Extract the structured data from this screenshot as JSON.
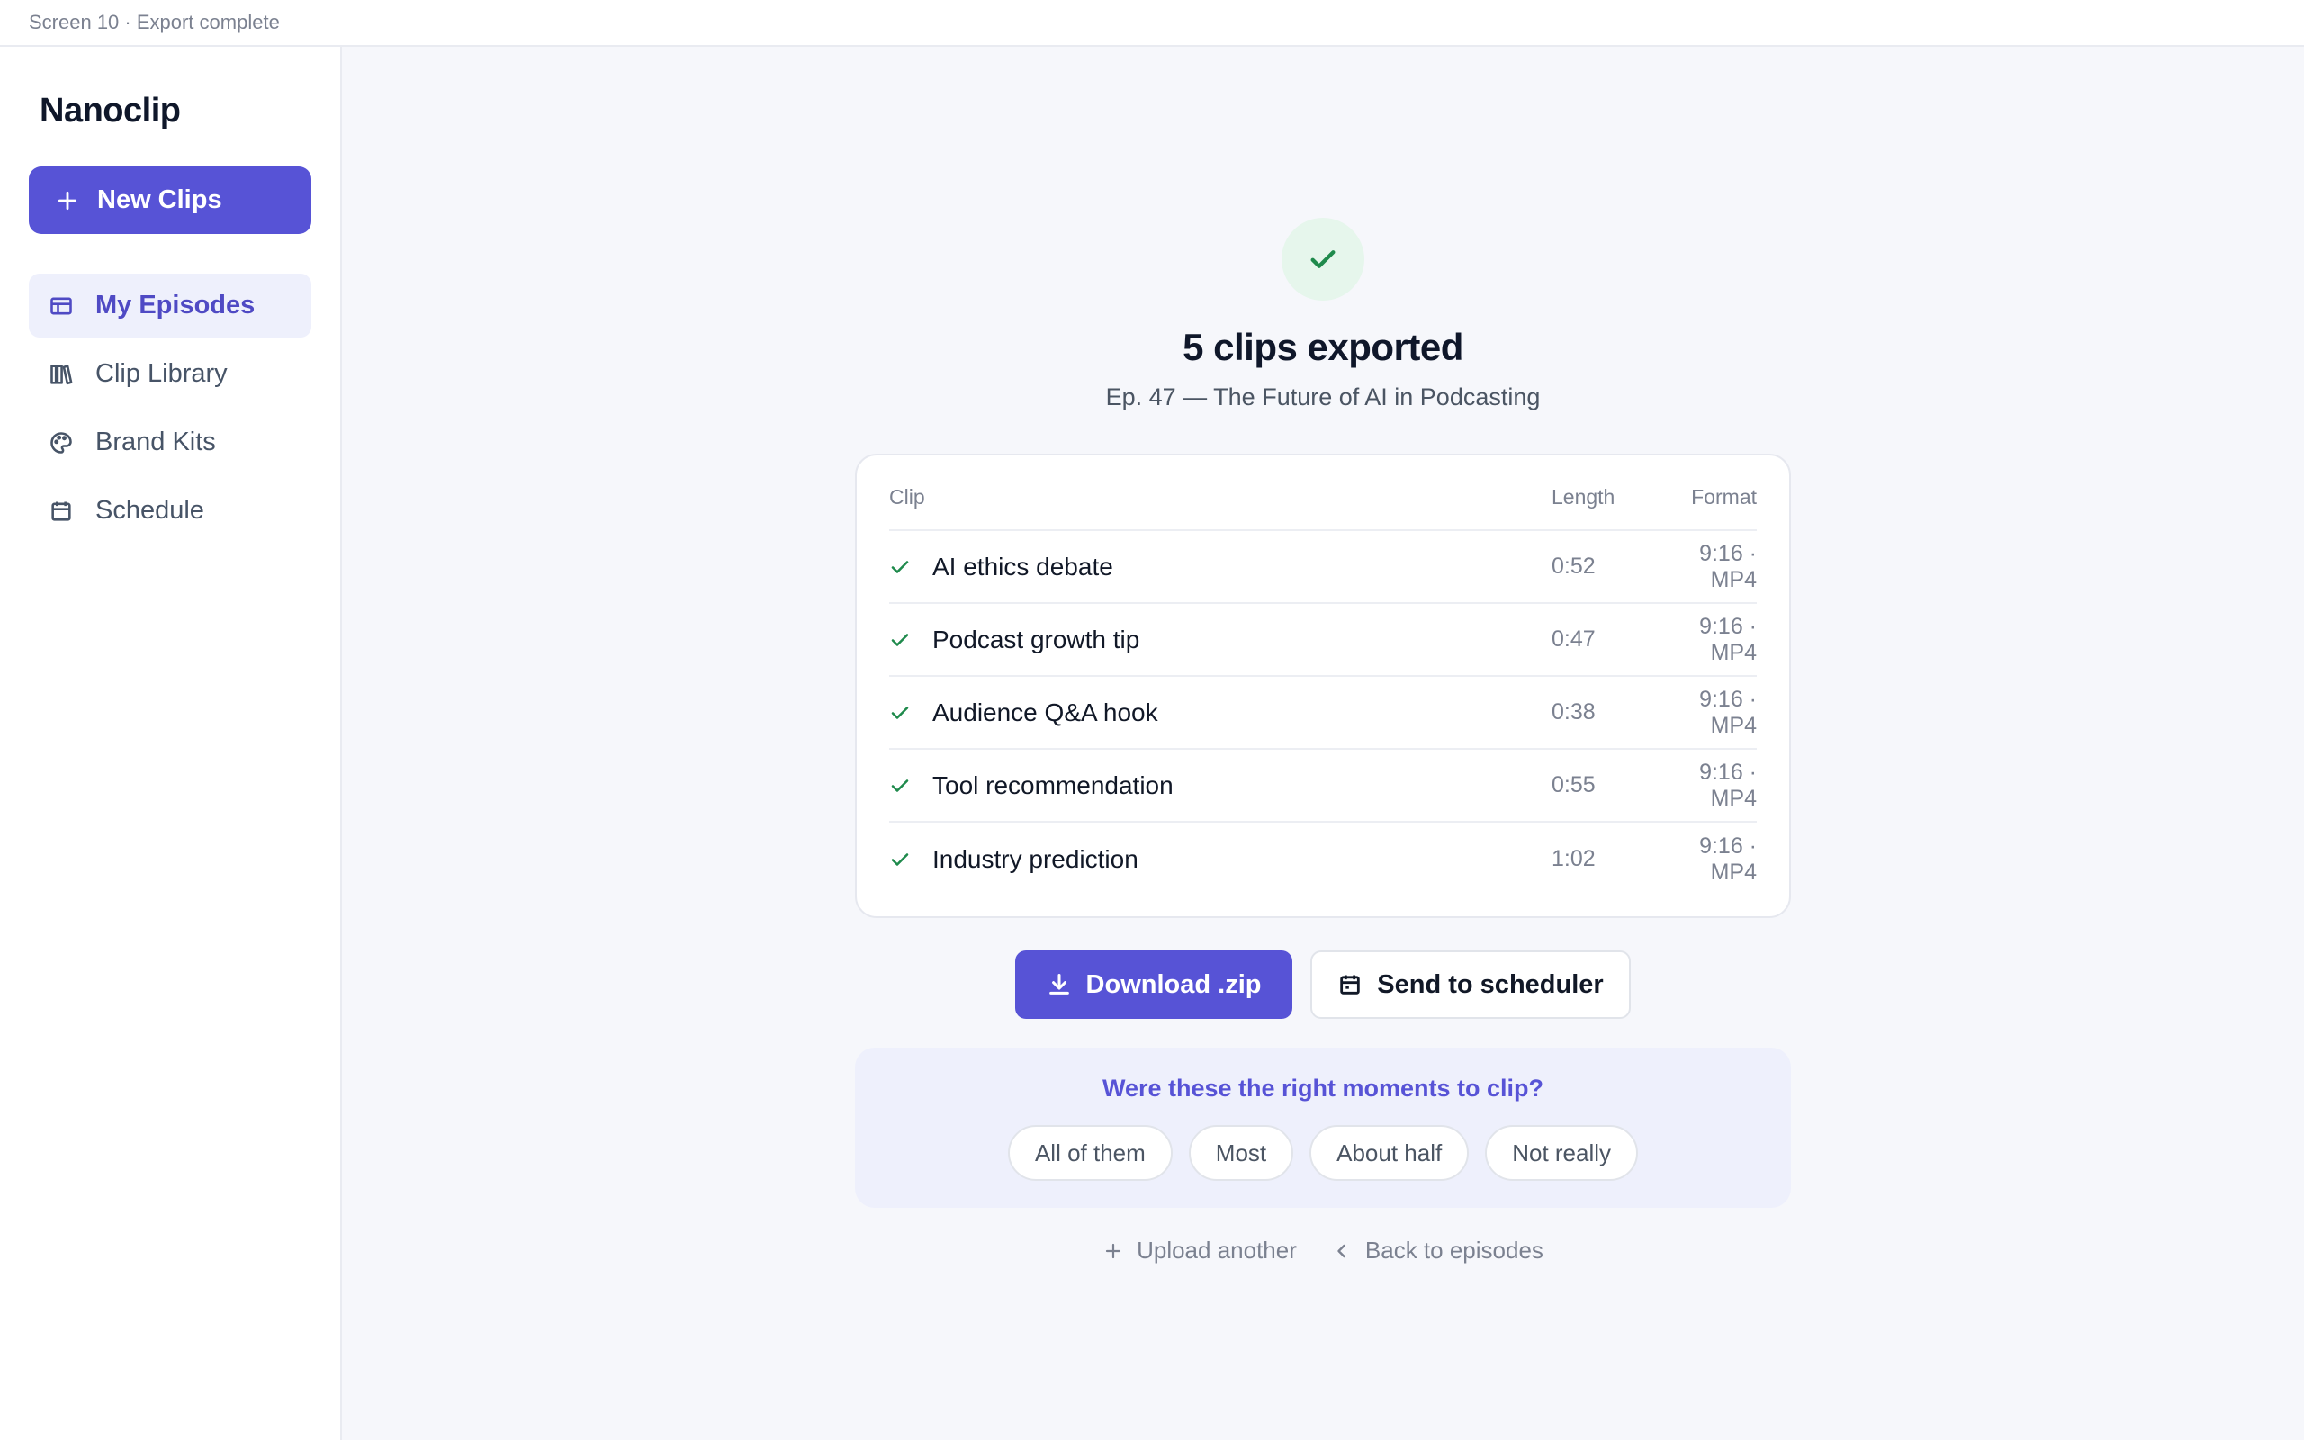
{
  "topbar": {
    "label": "Screen 10 · Export complete"
  },
  "sidebar": {
    "brand": "Nanoclip",
    "new_button": "New Clips",
    "items": [
      {
        "label": "My Episodes",
        "icon": "episodes-icon",
        "active": true
      },
      {
        "label": "Clip Library",
        "icon": "library-icon",
        "active": false
      },
      {
        "label": "Brand Kits",
        "icon": "palette-icon",
        "active": false
      },
      {
        "label": "Schedule",
        "icon": "calendar-icon",
        "active": false
      }
    ]
  },
  "main": {
    "title": "5 clips exported",
    "subtitle": "Ep. 47 — The Future of AI in Podcasting",
    "table": {
      "headers": {
        "clip": "Clip",
        "length": "Length",
        "format": "Format"
      },
      "rows": [
        {
          "name": "AI ethics debate",
          "length": "0:52",
          "format": "9:16 · MP4"
        },
        {
          "name": "Podcast growth tip",
          "length": "0:47",
          "format": "9:16 · MP4"
        },
        {
          "name": "Audience Q&A hook",
          "length": "0:38",
          "format": "9:16 · MP4"
        },
        {
          "name": "Tool recommendation",
          "length": "0:55",
          "format": "9:16 · MP4"
        },
        {
          "name": "Industry prediction",
          "length": "1:02",
          "format": "9:16 · MP4"
        }
      ]
    },
    "actions": {
      "download": "Download .zip",
      "scheduler": "Send to scheduler"
    },
    "feedback": {
      "question": "Were these the right moments to clip?",
      "options": [
        "All of them",
        "Most",
        "About half",
        "Not really"
      ]
    },
    "links": {
      "upload": "Upload another",
      "back": "Back to episodes"
    }
  },
  "colors": {
    "accent": "#5753d6",
    "success": "#1f8a4c",
    "active_bg": "#eef0fc"
  }
}
